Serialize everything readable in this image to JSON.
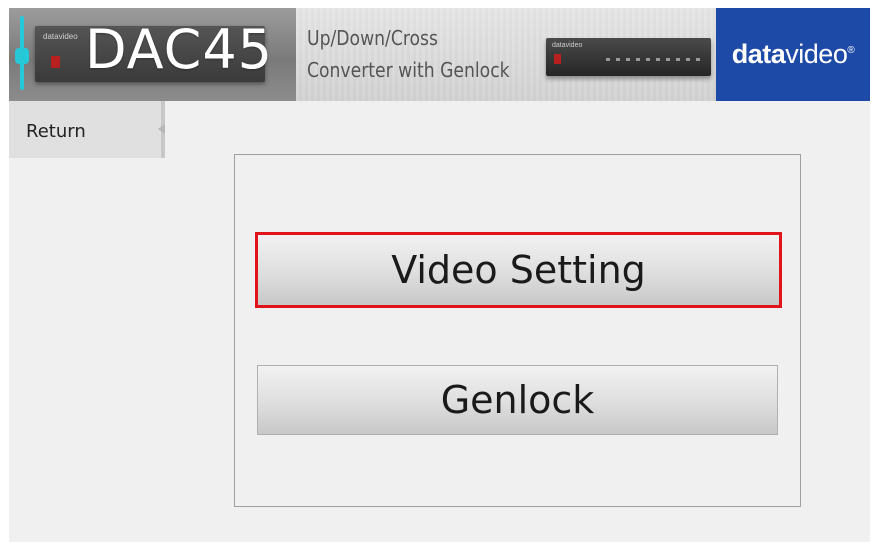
{
  "banner": {
    "product_name": "DAC45",
    "tagline_line1": "Up/Down/Cross",
    "tagline_line2": "Converter with Genlock",
    "device_brand": "datavideo",
    "logo": {
      "bold_part": "data",
      "light_part": "video",
      "registered": "®"
    },
    "colors": {
      "logo_background": "#1d4aa7",
      "slider_accent": "#27c8d8"
    }
  },
  "nav": {
    "return_label": "Return"
  },
  "menu": {
    "buttons": [
      {
        "label": "Video Setting",
        "highlighted": true
      },
      {
        "label": "Genlock",
        "highlighted": false
      }
    ],
    "highlight_color": "#e0141b"
  }
}
